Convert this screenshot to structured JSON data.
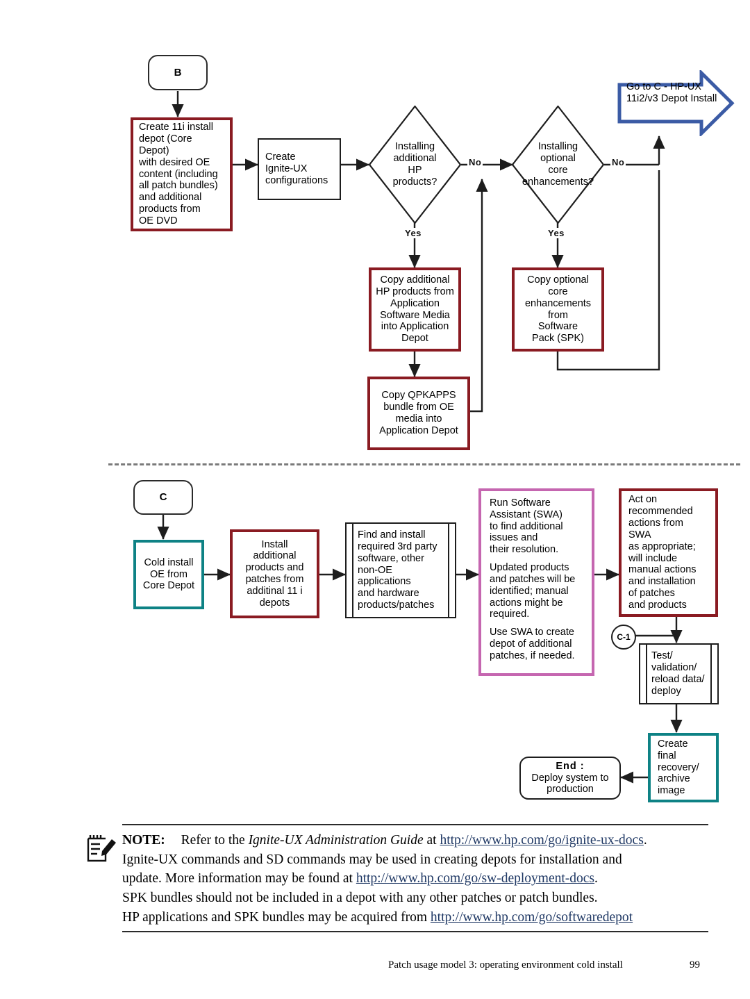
{
  "page": {
    "footer_text": "Patch usage model 3: operating environment cold install",
    "page_number": "99"
  },
  "colors": {
    "red": "#8A1B22",
    "teal": "#0E8285",
    "magenta": "#C566B0",
    "blue": "#3B5BA5",
    "black": "#1d1d1d",
    "link": "#1F3864"
  },
  "flowchart": {
    "type": "flowchart",
    "title": "Patch usage model 3: operating environment cold install",
    "sections": [
      {
        "id": "section-b",
        "start_connector": "B"
      },
      {
        "id": "section-c",
        "start_connector": "C"
      }
    ],
    "nodes": {
      "connector_b": {
        "label": "B",
        "shape": "terminator"
      },
      "create_depot": {
        "label": "Create 11i install\ndepot (Core Depot)\nwith desired OE\ncontent (including\nall patch bundles)\nand additional\nproducts from\nOE DVD",
        "shape": "process",
        "color": "red"
      },
      "create_ignite": {
        "label": "Create\nIgnite-UX\nconfigurations",
        "shape": "process",
        "color": "black"
      },
      "decision_hp_products": {
        "label": "Installing\nadditional\nHP\nproducts?",
        "shape": "decision"
      },
      "decision_core_enh": {
        "label": "Installing\noptional\ncore\nenhancements?",
        "shape": "decision"
      },
      "copy_hp_products": {
        "label": "Copy additional\nHP products from\nApplication\nSoftware Media\ninto Application\nDepot",
        "shape": "process",
        "color": "red"
      },
      "copy_qpkapps": {
        "label": "Copy QPKAPPS\nbundle from OE\nmedia into\nApplication Depot",
        "shape": "process",
        "color": "red"
      },
      "copy_core_enh": {
        "label": "Copy optional\ncore\nenhancements\nfrom\nSoftware\nPack (SPK)",
        "shape": "process",
        "color": "red"
      },
      "goto_c_banner": {
        "label": "Go to C - HP-UX\n11i2/v3 Depot Install",
        "shape": "arrow-banner",
        "color": "blue"
      },
      "connector_c": {
        "label": "C",
        "shape": "terminator"
      },
      "cold_install": {
        "label": "Cold install\nOE from\nCore Depot",
        "shape": "process",
        "color": "teal"
      },
      "install_additional": {
        "label": "Install\nadditional\nproducts and\npatches from\nadditinal 11 i\ndepots",
        "shape": "process",
        "color": "red"
      },
      "find_install_3rd": {
        "label": "Find and install\nrequired 3rd party\nsoftware, other\nnon-OE\napplications\nand hardware\nproducts/patches",
        "shape": "predefined-process",
        "color": "black"
      },
      "run_swa": {
        "shape": "process",
        "color": "magenta",
        "paragraphs": [
          "Run Software\nAssistant (SWA)\nto find additional\nissues and\ntheir resolution.",
          "Updated products\nand patches will be\nidentified; manual\nactions might be\nrequired.",
          "Use SWA to create\ndepot of additional\npatches, if needed."
        ]
      },
      "act_on_swa": {
        "label": "Act on\nrecommended\nactions from SWA\nas appropriate;\nwill include\nmanual actions\nand installation\nof patches\nand products",
        "shape": "process",
        "color": "red"
      },
      "connector_c1": {
        "label": "C-1",
        "shape": "circle-connector"
      },
      "test_validation": {
        "label": "Test/\nvalidation/\nreload data/\ndeploy",
        "shape": "predefined-process",
        "color": "black"
      },
      "create_recovery": {
        "label": "Create final\nrecovery/\narchive\nimage",
        "shape": "process",
        "color": "teal"
      },
      "end_node": {
        "title": "End :",
        "label": "Deploy system to\nproduction",
        "shape": "terminator"
      }
    },
    "edge_labels": {
      "no1": "No",
      "no2": "No",
      "yes1": "Yes",
      "yes2": "Yes"
    }
  },
  "note": {
    "label": "NOTE:",
    "icon": "note-pencil-icon",
    "line1_a": "Refer to the ",
    "line1_guide": "Ignite-UX Administration Guide",
    "line1_b": " at ",
    "line1_link": "http://www.hp.com/go/ignite-ux-docs",
    "line1_end": ".",
    "line2_a": "Ignite-UX commands and SD commands may be used in creating depots for installation and",
    "line2_b": "update. More information may be found at ",
    "line2_link": "http://www.hp.com/go/sw-deployment-docs",
    "line2_end": ".",
    "line3": "SPK bundles should not be included in a depot with any other patches or patch bundles.",
    "line4_a": "HP applications and SPK bundles may be acquired from ",
    "line4_link": "http://www.hp.com/go/softwaredepot"
  }
}
